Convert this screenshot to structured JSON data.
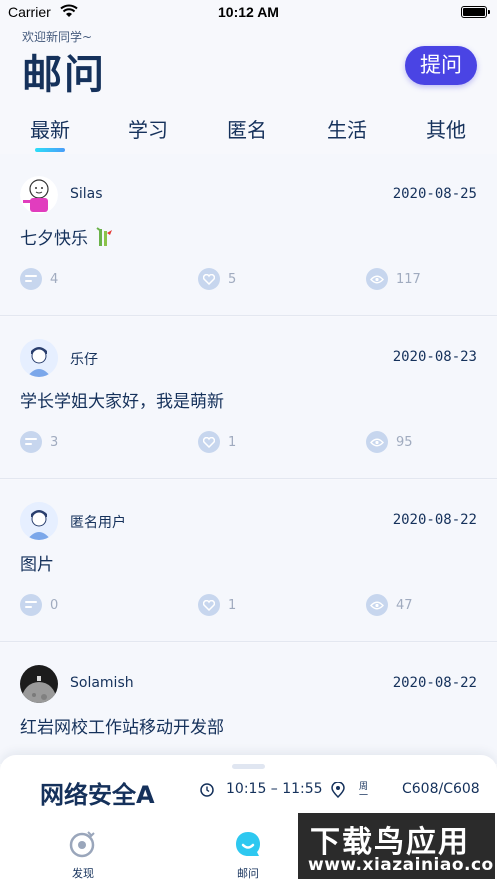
{
  "status_bar": {
    "carrier": "Carrier",
    "time": "10:12 AM"
  },
  "header": {
    "welcome": "欢迎新同学~",
    "title": "邮问",
    "ask_button": "提问",
    "tabs": [
      {
        "label": "最新",
        "active": true
      },
      {
        "label": "学习",
        "active": false
      },
      {
        "label": "匿名",
        "active": false
      },
      {
        "label": "生活",
        "active": false
      },
      {
        "label": "其他",
        "active": false
      }
    ]
  },
  "feed": {
    "items": [
      {
        "author": "Silas",
        "date": "2020-08-25",
        "content": "七夕快乐",
        "answers": "4",
        "likes": "5",
        "views": "117",
        "avatar": "cartoon-avatar"
      },
      {
        "author": "乐仔",
        "date": "2020-08-23",
        "content": "学长学姐大家好，我是萌新",
        "answers": "3",
        "likes": "1",
        "views": "95",
        "avatar": "default-avatar"
      },
      {
        "author": "匿名用户",
        "date": "2020-08-22",
        "content": "图片",
        "answers": "0",
        "likes": "1",
        "views": "47",
        "avatar": "default-avatar"
      },
      {
        "author": "Solamish",
        "date": "2020-08-22",
        "content": "红岩网校工作站移动开发部",
        "answers": "",
        "likes": "",
        "views": "",
        "avatar": "moon-avatar"
      }
    ]
  },
  "course_sheet": {
    "name": "网络安全A",
    "time": "10:15 – 11:55",
    "week": "周一",
    "room": "C608/C608"
  },
  "nav": {
    "items": [
      {
        "label": "发现",
        "icon": "discover-icon"
      },
      {
        "label": "邮问",
        "icon": "qa-icon",
        "active": true
      }
    ]
  },
  "watermark": {
    "line1": "下载鸟应用",
    "line2": "www.xiazainiao.com"
  },
  "colors": {
    "accent": "#4a44e4",
    "text": "#15315b",
    "background": "#f7f8fc",
    "icon": "#c7d6ee"
  }
}
